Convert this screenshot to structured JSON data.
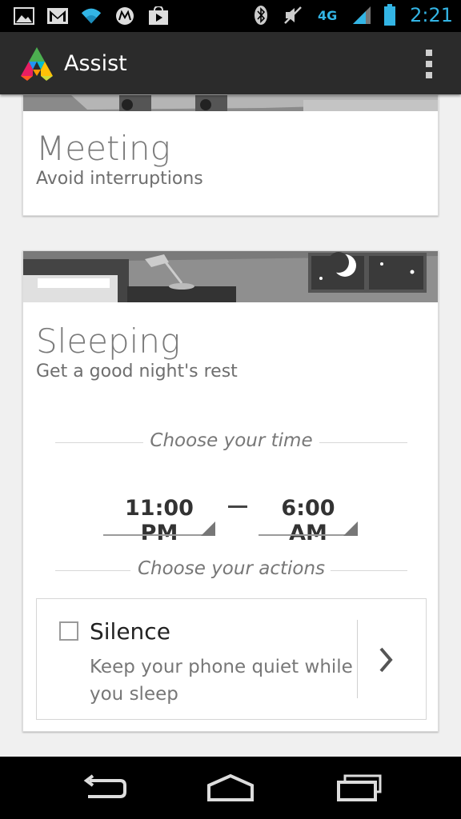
{
  "status_bar": {
    "time": "2:21",
    "icons": [
      "gallery-icon",
      "gmail-icon",
      "wifi-icon",
      "motorola-icon",
      "play-store-icon",
      "bluetooth-icon",
      "vibrate-icon",
      "4g-icon",
      "signal-icon",
      "battery-icon"
    ],
    "network_label": "4G"
  },
  "action_bar": {
    "app_title": "Assist",
    "logo_icon": "assist-logo-icon",
    "menu_icon": "overflow-menu-icon"
  },
  "cards": {
    "meeting": {
      "title": "Meeting",
      "subtitle": "Avoid interruptions"
    },
    "sleeping": {
      "title": "Sleeping",
      "subtitle": "Get a good night's rest",
      "choose_time_label": "Choose your time",
      "start_time": "11:00 PM",
      "end_time": "6:00 AM",
      "choose_actions_label": "Choose your actions",
      "action": {
        "title": "Silence",
        "description": "Keep your phone quiet while you sleep",
        "checked": false
      }
    }
  },
  "nav_bar": {
    "buttons": [
      "back-icon",
      "home-icon",
      "recent-apps-icon"
    ]
  },
  "colors": {
    "status_accent": "#33b5e5",
    "action_bar_bg": "#2b2b2b",
    "page_bg": "#f0f0f0"
  }
}
